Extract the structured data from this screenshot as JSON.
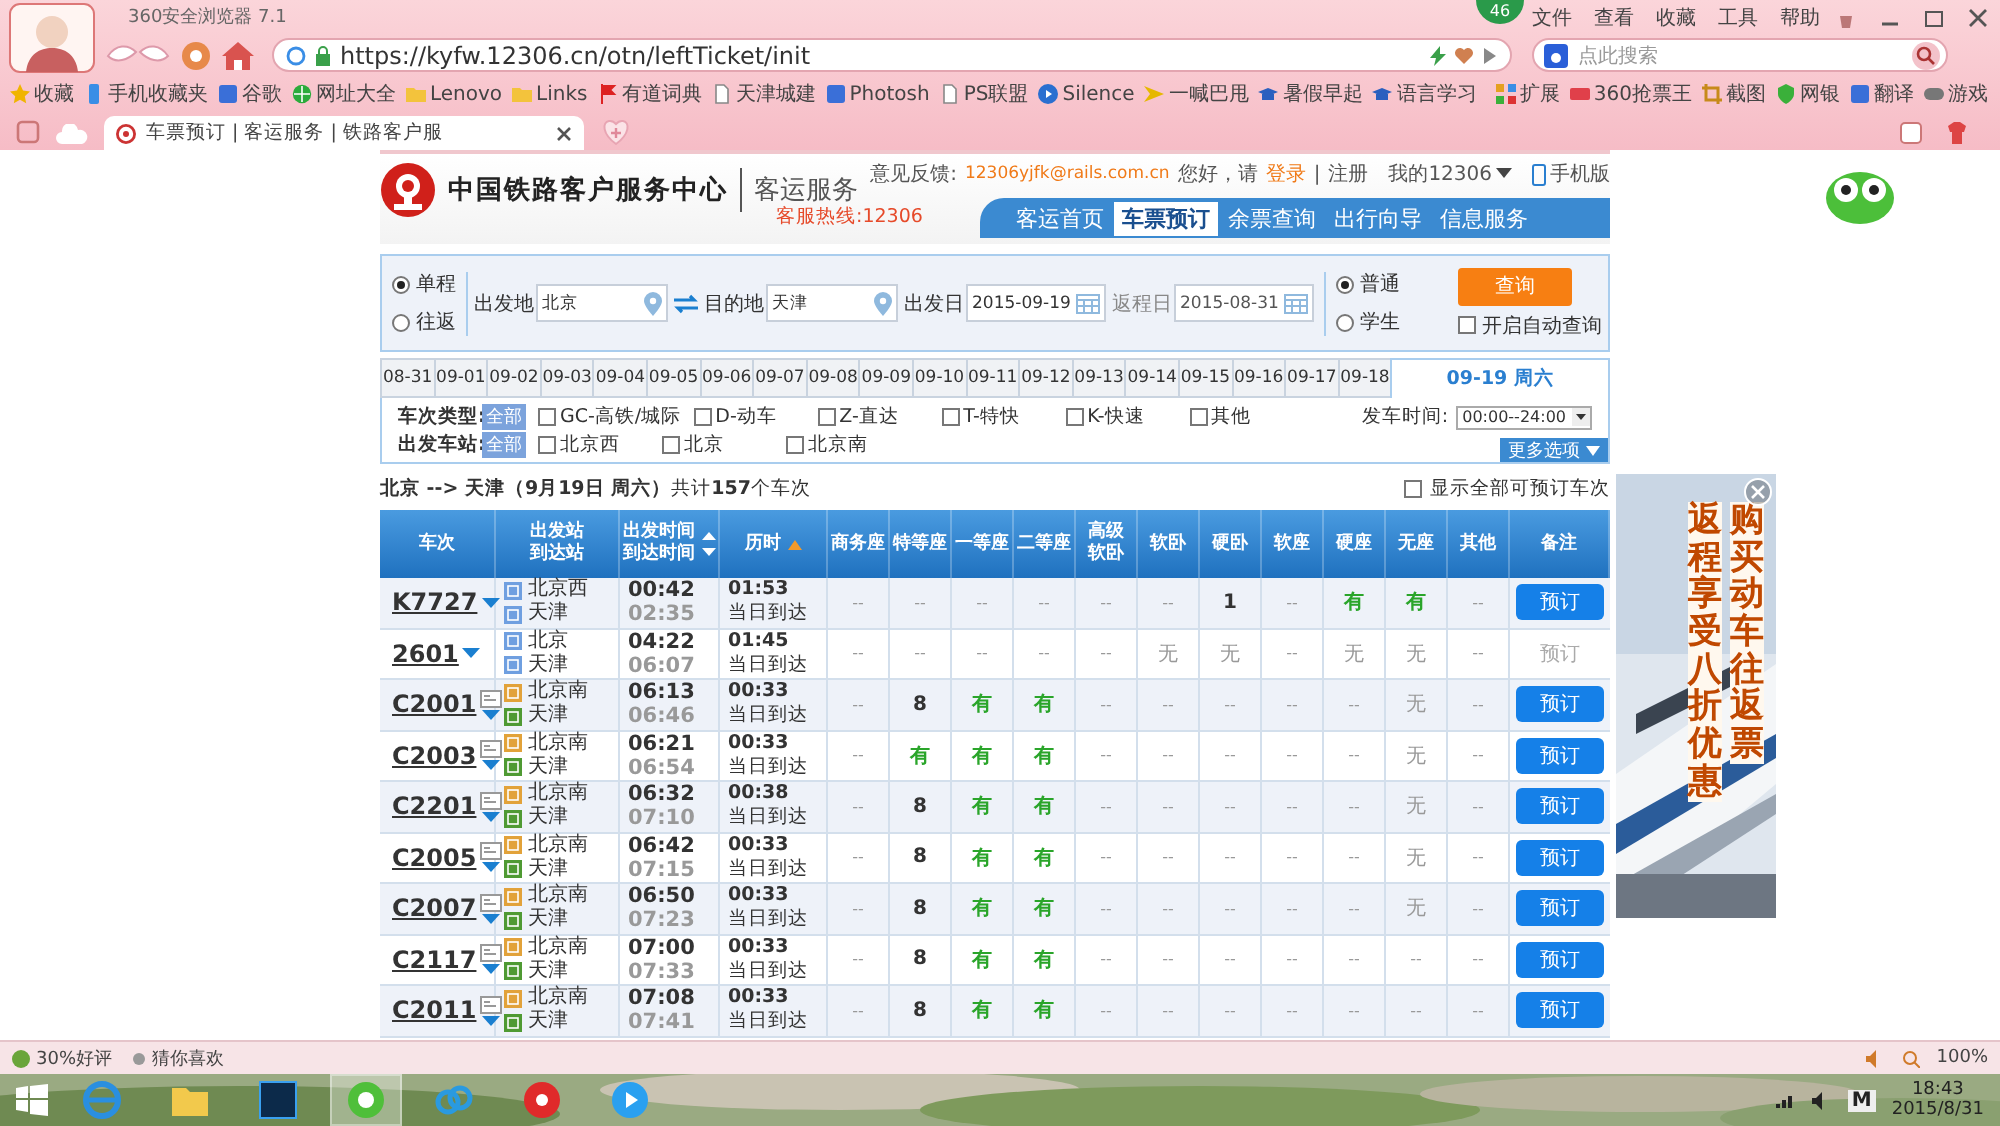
{
  "browser": {
    "title": "360安全浏览器 7.1",
    "menu": [
      "文件",
      "查看",
      "收藏",
      "工具",
      "帮助"
    ],
    "badge": "46",
    "url": "https://kyfw.12306.cn/otn/leftTicket/init",
    "search_placeholder": "点此搜索",
    "bookmarks": [
      {
        "label": "收藏",
        "kind": "star"
      },
      {
        "label": "手机收藏夹",
        "kind": "phone"
      },
      {
        "label": "谷歌",
        "kind": "square"
      },
      {
        "label": "网址大全",
        "kind": "globe"
      },
      {
        "label": "Lenovo",
        "kind": "folder"
      },
      {
        "label": "Links",
        "kind": "folder"
      },
      {
        "label": "有道词典",
        "kind": "flag"
      },
      {
        "label": "天津城建",
        "kind": "page"
      },
      {
        "label": "Photosh",
        "kind": "square"
      },
      {
        "label": "PS联盟",
        "kind": "page"
      },
      {
        "label": "Silence",
        "kind": "play"
      },
      {
        "label": "一喊巴甩",
        "kind": "arrow"
      },
      {
        "label": "暑假早起",
        "kind": "cap"
      },
      {
        "label": "语言学习",
        "kind": "cap"
      }
    ],
    "extensions": [
      {
        "label": "扩展",
        "kind": "grid"
      },
      {
        "label": "360抢票王",
        "kind": "ticket"
      },
      {
        "label": "截图",
        "kind": "crop"
      },
      {
        "label": "网银",
        "kind": "shield"
      },
      {
        "label": "翻译",
        "kind": "square"
      },
      {
        "label": "游戏",
        "kind": "gamepad"
      }
    ],
    "tab": {
      "title": "车票预订 | 客运服务 | 铁路客户服",
      "selected": true
    }
  },
  "header": {
    "site_title": "中国铁路客户服务中心",
    "subtitle": "客运服务",
    "hotline": "客服热线:12306",
    "feedback_label": "意见反馈:",
    "feedback_email": "12306yjfk@rails.com.cn",
    "greeting": "您好，请",
    "login": "登录",
    "separator": "|",
    "register": "注册",
    "my_account": "我的12306",
    "mobile": "手机版",
    "nav": [
      {
        "label": "客运首页",
        "selected": false
      },
      {
        "label": "车票预订",
        "selected": true
      },
      {
        "label": "余票查询",
        "selected": false
      },
      {
        "label": "出行向导",
        "selected": false
      },
      {
        "label": "信息服务",
        "selected": false
      }
    ]
  },
  "search": {
    "trip_types": [
      {
        "label": "单程",
        "selected": true
      },
      {
        "label": "往返",
        "selected": false
      }
    ],
    "from": {
      "label": "出发地",
      "value": "北京"
    },
    "to": {
      "label": "目的地",
      "value": "天津"
    },
    "depart": {
      "label": "出发日",
      "value": "2015-09-19"
    },
    "return": {
      "label": "返程日",
      "value": "2015-08-31",
      "disabled": true
    },
    "passenger_types": [
      {
        "label": "普通",
        "selected": true
      },
      {
        "label": "学生",
        "selected": false
      }
    ],
    "query_button": "查询",
    "auto_query": {
      "label": "开启自动查询",
      "checked": false
    }
  },
  "dates": [
    {
      "label": "08-31",
      "selected": false
    },
    {
      "label": "09-01",
      "selected": false
    },
    {
      "label": "09-02",
      "selected": false
    },
    {
      "label": "09-03",
      "selected": false
    },
    {
      "label": "09-04",
      "selected": false
    },
    {
      "label": "09-05",
      "selected": false
    },
    {
      "label": "09-06",
      "selected": false
    },
    {
      "label": "09-07",
      "selected": false
    },
    {
      "label": "09-08",
      "selected": false
    },
    {
      "label": "09-09",
      "selected": false
    },
    {
      "label": "09-10",
      "selected": false
    },
    {
      "label": "09-11",
      "selected": false
    },
    {
      "label": "09-12",
      "selected": false
    },
    {
      "label": "09-13",
      "selected": false
    },
    {
      "label": "09-14",
      "selected": false
    },
    {
      "label": "09-15",
      "selected": false
    },
    {
      "label": "09-16",
      "selected": false
    },
    {
      "label": "09-17",
      "selected": false
    },
    {
      "label": "09-18",
      "selected": false
    },
    {
      "label": "09-19 周六",
      "selected": true
    }
  ],
  "filters": {
    "type_label": "车次类型:",
    "type_all": "全部",
    "types": [
      {
        "label": "GC-高铁/城际",
        "checked": false
      },
      {
        "label": "D-动车",
        "checked": false
      },
      {
        "label": "Z-直达",
        "checked": false
      },
      {
        "label": "T-特快",
        "checked": false
      },
      {
        "label": "K-快速",
        "checked": false
      },
      {
        "label": "其他",
        "checked": false
      }
    ],
    "station_label": "出发车站:",
    "station_all": "全部",
    "stations": [
      {
        "label": "北京西",
        "checked": false
      },
      {
        "label": "北京",
        "checked": false
      },
      {
        "label": "北京南",
        "checked": false
      }
    ],
    "time_label": "发车时间:",
    "time_value": "00:00--24:00",
    "more_button": "更多选项"
  },
  "summary": {
    "text": "**北京 --> 天津（9月19日  周六）**共计**157**个车次",
    "show_all": {
      "label": "显示全部可预订车次",
      "checked": false
    }
  },
  "table": {
    "columns": [
      {
        "lines": [
          "车次"
        ]
      },
      {
        "lines": [
          "出发站",
          "到达站"
        ]
      },
      {
        "lines": [
          "出发时间",
          "到达时间"
        ],
        "kind": "toggle"
      },
      {
        "lines": [
          "历时"
        ],
        "kind": "ascending"
      },
      {
        "lines": [
          "商务座"
        ]
      },
      {
        "lines": [
          "特等座"
        ]
      },
      {
        "lines": [
          "一等座"
        ]
      },
      {
        "lines": [
          "二等座"
        ]
      },
      {
        "lines": [
          "高级",
          "软卧"
        ]
      },
      {
        "lines": [
          "软卧"
        ]
      },
      {
        "lines": [
          "硬卧"
        ]
      },
      {
        "lines": [
          "软座"
        ]
      },
      {
        "lines": [
          "硬座"
        ]
      },
      {
        "lines": [
          "无座"
        ]
      },
      {
        "lines": [
          "其他"
        ]
      },
      {
        "lines": [
          "备注"
        ]
      }
    ],
    "rows": [
      {
        "train": "K7727",
        "info_icon": false,
        "from": {
          "name": "北京西",
          "kind": "pass"
        },
        "to": {
          "name": "天津",
          "kind": "pass"
        },
        "depart": "00:42",
        "arrive": "02:35",
        "duration": "01:53",
        "arrival_day": "当日到达",
        "seats": [
          {
            "text": "--",
            "kind": "na"
          },
          {
            "text": "--",
            "kind": "na"
          },
          {
            "text": "--",
            "kind": "na"
          },
          {
            "text": "--",
            "kind": "na"
          },
          {
            "text": "--",
            "kind": "na"
          },
          {
            "text": "--",
            "kind": "na"
          },
          {
            "text": "1",
            "kind": "count"
          },
          {
            "text": "--",
            "kind": "na"
          },
          {
            "text": "有",
            "kind": "yes"
          },
          {
            "text": "有",
            "kind": "yes"
          },
          {
            "text": "--",
            "kind": "na"
          }
        ],
        "book": "预订",
        "bookable": true
      },
      {
        "train": "2601",
        "info_icon": false,
        "from": {
          "name": "北京",
          "kind": "pass"
        },
        "to": {
          "name": "天津",
          "kind": "pass"
        },
        "depart": "04:22",
        "arrive": "06:07",
        "duration": "01:45",
        "arrival_day": "当日到达",
        "seats": [
          {
            "text": "--",
            "kind": "na"
          },
          {
            "text": "--",
            "kind": "na"
          },
          {
            "text": "--",
            "kind": "na"
          },
          {
            "text": "--",
            "kind": "na"
          },
          {
            "text": "--",
            "kind": "na"
          },
          {
            "text": "无",
            "kind": "no"
          },
          {
            "text": "无",
            "kind": "no"
          },
          {
            "text": "--",
            "kind": "na"
          },
          {
            "text": "无",
            "kind": "no"
          },
          {
            "text": "无",
            "kind": "no"
          },
          {
            "text": "--",
            "kind": "na"
          }
        ],
        "book": "预订",
        "bookable": false
      },
      {
        "train": "C2001",
        "info_icon": true,
        "from": {
          "name": "北京南",
          "kind": "start"
        },
        "to": {
          "name": "天津",
          "kind": "end"
        },
        "depart": "06:13",
        "arrive": "06:46",
        "duration": "00:33",
        "arrival_day": "当日到达",
        "seats": [
          {
            "text": "--",
            "kind": "na"
          },
          {
            "text": "8",
            "kind": "count"
          },
          {
            "text": "有",
            "kind": "yes"
          },
          {
            "text": "有",
            "kind": "yes"
          },
          {
            "text": "--",
            "kind": "na"
          },
          {
            "text": "--",
            "kind": "na"
          },
          {
            "text": "--",
            "kind": "na"
          },
          {
            "text": "--",
            "kind": "na"
          },
          {
            "text": "--",
            "kind": "na"
          },
          {
            "text": "无",
            "kind": "no"
          },
          {
            "text": "--",
            "kind": "na"
          }
        ],
        "book": "预订",
        "bookable": true
      },
      {
        "train": "C2003",
        "info_icon": true,
        "from": {
          "name": "北京南",
          "kind": "start"
        },
        "to": {
          "name": "天津",
          "kind": "end"
        },
        "depart": "06:21",
        "arrive": "06:54",
        "duration": "00:33",
        "arrival_day": "当日到达",
        "seats": [
          {
            "text": "--",
            "kind": "na"
          },
          {
            "text": "有",
            "kind": "yes"
          },
          {
            "text": "有",
            "kind": "yes"
          },
          {
            "text": "有",
            "kind": "yes"
          },
          {
            "text": "--",
            "kind": "na"
          },
          {
            "text": "--",
            "kind": "na"
          },
          {
            "text": "--",
            "kind": "na"
          },
          {
            "text": "--",
            "kind": "na"
          },
          {
            "text": "--",
            "kind": "na"
          },
          {
            "text": "无",
            "kind": "no"
          },
          {
            "text": "--",
            "kind": "na"
          }
        ],
        "book": "预订",
        "bookable": true
      },
      {
        "train": "C2201",
        "info_icon": true,
        "from": {
          "name": "北京南",
          "kind": "start"
        },
        "to": {
          "name": "天津",
          "kind": "end"
        },
        "depart": "06:32",
        "arrive": "07:10",
        "duration": "00:38",
        "arrival_day": "当日到达",
        "seats": [
          {
            "text": "--",
            "kind": "na"
          },
          {
            "text": "8",
            "kind": "count"
          },
          {
            "text": "有",
            "kind": "yes"
          },
          {
            "text": "有",
            "kind": "yes"
          },
          {
            "text": "--",
            "kind": "na"
          },
          {
            "text": "--",
            "kind": "na"
          },
          {
            "text": "--",
            "kind": "na"
          },
          {
            "text": "--",
            "kind": "na"
          },
          {
            "text": "--",
            "kind": "na"
          },
          {
            "text": "无",
            "kind": "no"
          },
          {
            "text": "--",
            "kind": "na"
          }
        ],
        "book": "预订",
        "bookable": true
      },
      {
        "train": "C2005",
        "info_icon": true,
        "from": {
          "name": "北京南",
          "kind": "start"
        },
        "to": {
          "name": "天津",
          "kind": "end"
        },
        "depart": "06:42",
        "arrive": "07:15",
        "duration": "00:33",
        "arrival_day": "当日到达",
        "seats": [
          {
            "text": "--",
            "kind": "na"
          },
          {
            "text": "8",
            "kind": "count"
          },
          {
            "text": "有",
            "kind": "yes"
          },
          {
            "text": "有",
            "kind": "yes"
          },
          {
            "text": "--",
            "kind": "na"
          },
          {
            "text": "--",
            "kind": "na"
          },
          {
            "text": "--",
            "kind": "na"
          },
          {
            "text": "--",
            "kind": "na"
          },
          {
            "text": "--",
            "kind": "na"
          },
          {
            "text": "无",
            "kind": "no"
          },
          {
            "text": "--",
            "kind": "na"
          }
        ],
        "book": "预订",
        "bookable": true
      },
      {
        "train": "C2007",
        "info_icon": true,
        "from": {
          "name": "北京南",
          "kind": "start"
        },
        "to": {
          "name": "天津",
          "kind": "end"
        },
        "depart": "06:50",
        "arrive": "07:23",
        "duration": "00:33",
        "arrival_day": "当日到达",
        "seats": [
          {
            "text": "--",
            "kind": "na"
          },
          {
            "text": "8",
            "kind": "count"
          },
          {
            "text": "有",
            "kind": "yes"
          },
          {
            "text": "有",
            "kind": "yes"
          },
          {
            "text": "--",
            "kind": "na"
          },
          {
            "text": "--",
            "kind": "na"
          },
          {
            "text": "--",
            "kind": "na"
          },
          {
            "text": "--",
            "kind": "na"
          },
          {
            "text": "--",
            "kind": "na"
          },
          {
            "text": "无",
            "kind": "no"
          },
          {
            "text": "--",
            "kind": "na"
          }
        ],
        "book": "预订",
        "bookable": true
      },
      {
        "train": "C2117",
        "info_icon": true,
        "from": {
          "name": "北京南",
          "kind": "start"
        },
        "to": {
          "name": "天津",
          "kind": "end"
        },
        "depart": "07:00",
        "arrive": "07:33",
        "duration": "00:33",
        "arrival_day": "当日到达",
        "seats": [
          {
            "text": "--",
            "kind": "na"
          },
          {
            "text": "8",
            "kind": "count"
          },
          {
            "text": "有",
            "kind": "yes"
          },
          {
            "text": "有",
            "kind": "yes"
          },
          {
            "text": "--",
            "kind": "na"
          },
          {
            "text": "--",
            "kind": "na"
          },
          {
            "text": "--",
            "kind": "na"
          },
          {
            "text": "--",
            "kind": "na"
          },
          {
            "text": "--",
            "kind": "na"
          },
          {
            "text": "--",
            "kind": "na"
          },
          {
            "text": "--",
            "kind": "na"
          }
        ],
        "book": "预订",
        "bookable": true
      },
      {
        "train": "C2011",
        "info_icon": true,
        "from": {
          "name": "北京南",
          "kind": "start"
        },
        "to": {
          "name": "天津",
          "kind": "end"
        },
        "depart": "07:08",
        "arrive": "07:41",
        "duration": "00:33",
        "arrival_day": "当日到达",
        "seats": [
          {
            "text": "--",
            "kind": "na"
          },
          {
            "text": "8",
            "kind": "count"
          },
          {
            "text": "有",
            "kind": "yes"
          },
          {
            "text": "有",
            "kind": "yes"
          },
          {
            "text": "--",
            "kind": "na"
          },
          {
            "text": "--",
            "kind": "na"
          },
          {
            "text": "--",
            "kind": "na"
          },
          {
            "text": "--",
            "kind": "na"
          },
          {
            "text": "--",
            "kind": "na"
          },
          {
            "text": "--",
            "kind": "na"
          },
          {
            "text": "--",
            "kind": "na"
          }
        ],
        "book": "预订",
        "bookable": true
      }
    ]
  },
  "ad": {
    "lines": [
      "返程享受八折优惠",
      "购买动车往返票"
    ]
  },
  "status_bar": {
    "items": [
      "30%好评",
      "猜你喜欢"
    ],
    "zoom": "100%"
  },
  "taskbar": {
    "apps": [
      {
        "kind": "ie",
        "active": false
      },
      {
        "kind": "folder",
        "active": false
      },
      {
        "kind": "ps",
        "active": false
      },
      {
        "kind": "browser",
        "active": true
      },
      {
        "kind": "cloud",
        "active": false
      },
      {
        "kind": "music",
        "active": false
      },
      {
        "kind": "player",
        "active": false
      }
    ],
    "ime": "M",
    "time": "18:43",
    "date": "2015/8/31"
  }
}
